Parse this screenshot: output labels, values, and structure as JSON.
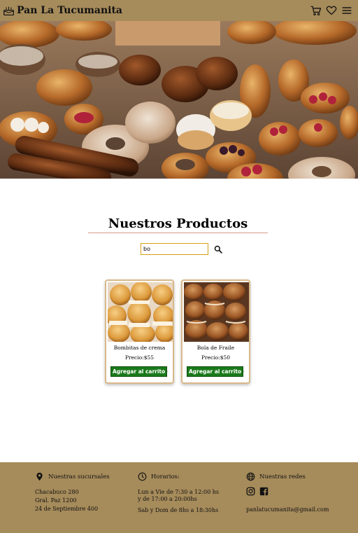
{
  "header": {
    "logo_icon": "bread-cake-icon",
    "title": "Pan La Tucumanita",
    "cart_icon": "cart-icon",
    "favorites_icon": "heart-icon",
    "menu_icon": "hamburger-menu-icon"
  },
  "hero": {
    "image": "bakery-pastries-photo"
  },
  "products": {
    "title": "Nuestros Productos",
    "search_value": "bo",
    "search_icon": "search-icon",
    "items": [
      {
        "name": "Bombitas de crema",
        "price": "Precio:$55",
        "add_label": "Agregar al carrito",
        "image": "cream-puffs-photo"
      },
      {
        "name": "Bola de Fraile",
        "price": "Precio:$50",
        "add_label": "Agregar al carrito",
        "image": "bola-de-fraile-photo"
      }
    ]
  },
  "footer": {
    "branches": {
      "title": "Nuestras sucursales",
      "icon": "location-pin-icon",
      "lines": [
        "Chacabuco 280",
        "Gral. Paz 1200",
        "24 de Septiembre 400"
      ]
    },
    "hours": {
      "title": "Horarios:",
      "icon": "clock-icon",
      "lines": [
        "Lun a Vie de 7:30 a 12:00 hs",
        "y de 17:00 a 20:00hs",
        "Sab y Dom de 8hs a 18:30hs"
      ]
    },
    "social": {
      "title": "Nuestras redes",
      "icon": "globe-icon",
      "networks": [
        "instagram-icon",
        "facebook-icon"
      ],
      "email": "panlatucumanita@gmail.com"
    }
  },
  "colors": {
    "header_bg": "#a68b5b",
    "footer_bg": "#a68b5b",
    "add_button": "#1a7a1a",
    "card_border": "#d8b98a",
    "search_border": "#d4a017",
    "title_underline": "#d89a8a"
  }
}
